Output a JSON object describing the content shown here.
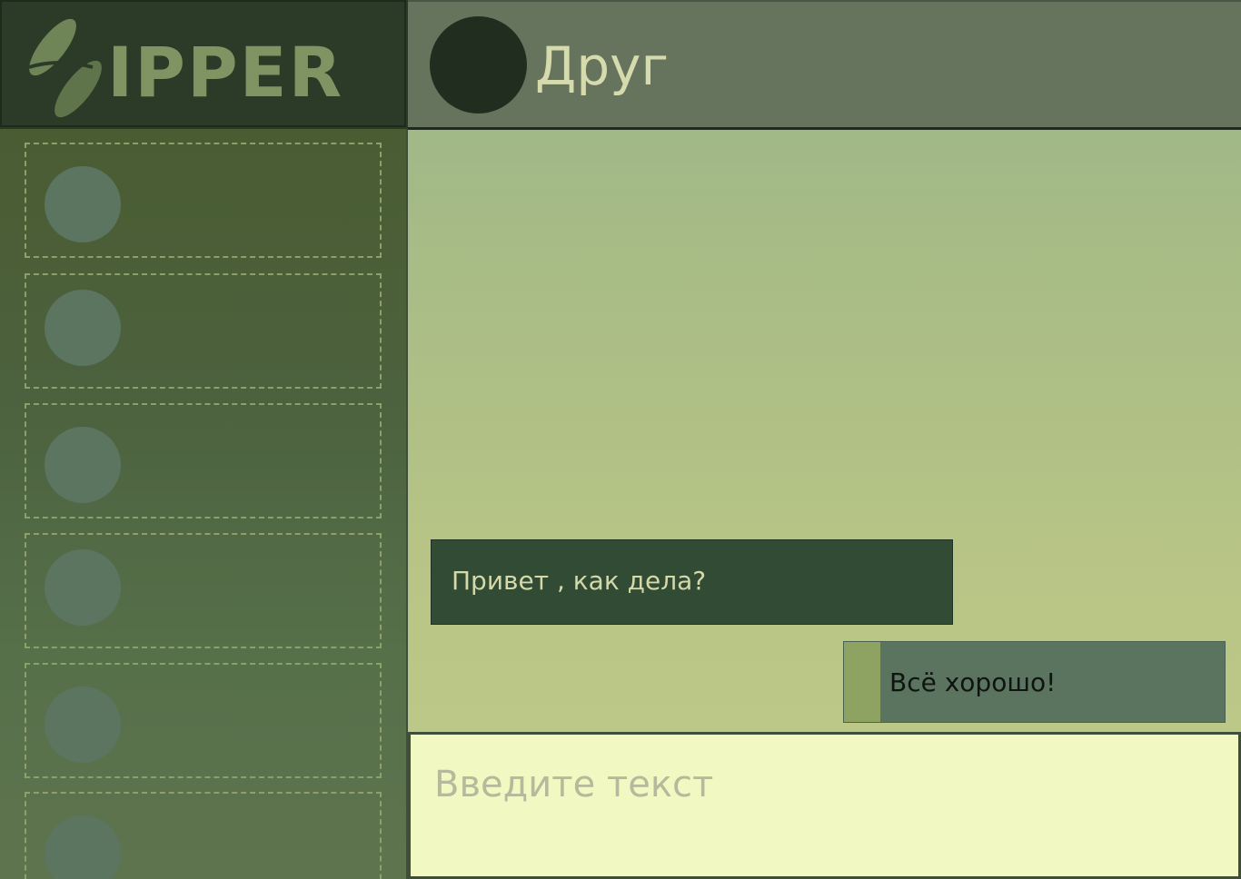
{
  "app": {
    "logo_text": "IPPER"
  },
  "header": {
    "contact_name": "Друг"
  },
  "sidebar": {
    "contacts": [
      {
        "avatar": "avatar-placeholder"
      },
      {
        "avatar": "avatar-placeholder"
      },
      {
        "avatar": "avatar-placeholder"
      },
      {
        "avatar": "avatar-placeholder"
      },
      {
        "avatar": "avatar-placeholder"
      },
      {
        "avatar": "avatar-placeholder"
      }
    ]
  },
  "messages": [
    {
      "direction": "incoming",
      "text": "Привет , как дела?"
    },
    {
      "direction": "outgoing",
      "text": "Всё хорошо!"
    }
  ],
  "composer": {
    "placeholder": "Введите текст",
    "value": ""
  },
  "colors": {
    "logo_panel": "#2b3b28",
    "header": "#67745d",
    "incoming_bubble": "#324b35",
    "outgoing_bubble": "#5b7460",
    "outgoing_accent": "#8ea362",
    "input_bg": "#f1f8c2"
  }
}
